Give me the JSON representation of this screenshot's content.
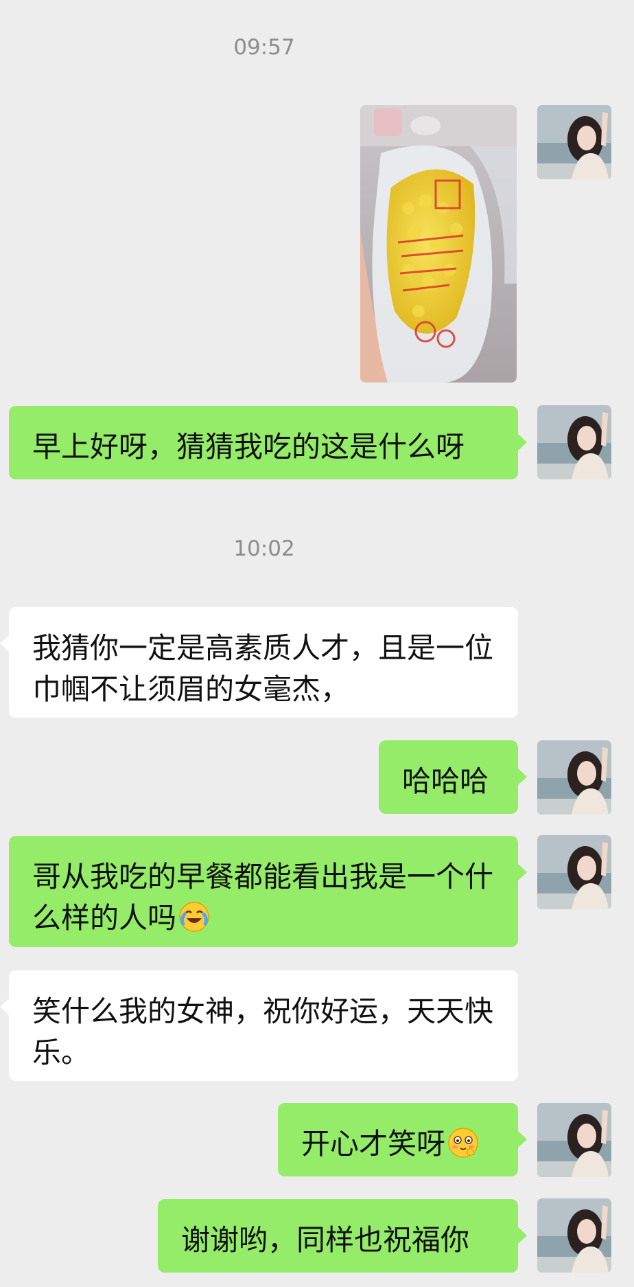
{
  "timestamps": [
    "09:57",
    "10:02"
  ],
  "messages": [
    {
      "sender": "me",
      "type": "image",
      "image": "bag-of-corn-photo"
    },
    {
      "sender": "me",
      "text": "早上好呀，猜猜我吃的这是什么呀"
    },
    {
      "sender": "other",
      "text": "我猜你一定是高素质人才，且是一位巾帼不让须眉的女毫杰，"
    },
    {
      "sender": "me",
      "text": "哈哈哈"
    },
    {
      "sender": "me",
      "text": "哥从我吃的早餐都能看出我是一个什么样的人吗",
      "emoji": "crying-laughing-emoji"
    },
    {
      "sender": "other",
      "text": "笑什么我的女神，祝你好运，天天快乐。"
    },
    {
      "sender": "me",
      "text": "开心才笑呀",
      "emoji": "shy-emoji"
    },
    {
      "sender": "me",
      "text": "谢谢哟，同样也祝福你"
    }
  ],
  "colors": {
    "background": "#ededed",
    "my_bubble": "#95ec69",
    "other_bubble": "#ffffff",
    "timestamp": "#8c8c8c"
  }
}
